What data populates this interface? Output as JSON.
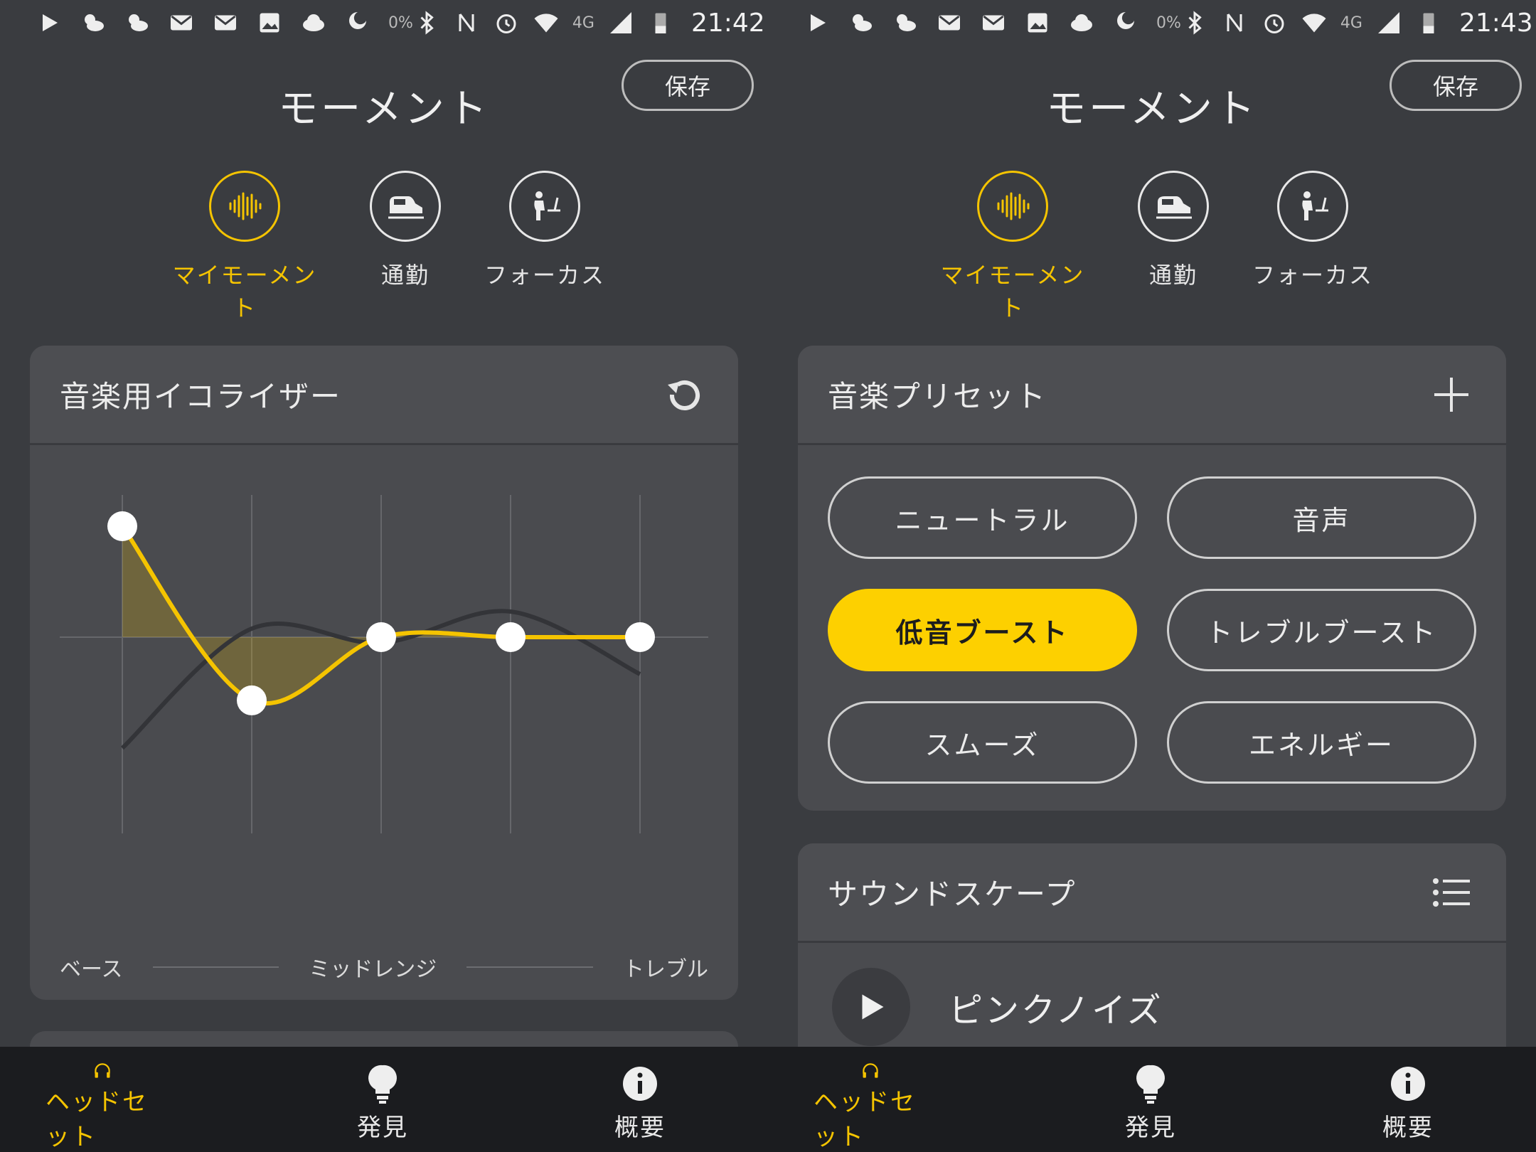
{
  "accent_color": "#f5c400",
  "screens": [
    {
      "status": {
        "time": "21:42",
        "network": "4G",
        "battery_small": "0%"
      },
      "header": {
        "title": "モーメント",
        "save_label": "保存"
      },
      "moments": [
        {
          "label": "マイモーメント",
          "icon": "waveform-icon",
          "active": true
        },
        {
          "label": "通勤",
          "icon": "train-icon",
          "active": false
        },
        {
          "label": "フォーカス",
          "icon": "focus-person-icon",
          "active": false
        }
      ],
      "eq_card": {
        "title": "音楽用イコライザー",
        "action_icon": "reset-icon",
        "legend": {
          "bass": "ベース",
          "mid": "ミッドレンジ",
          "treble": "トレブル"
        },
        "bands": [
          1.0,
          -0.57,
          0.0,
          0.0,
          0.0
        ],
        "range": [
          -1,
          1
        ]
      }
    },
    {
      "status": {
        "time": "21:43",
        "network": "4G",
        "battery_small": "0%"
      },
      "header": {
        "title": "モーメント",
        "save_label": "保存"
      },
      "moments": [
        {
          "label": "マイモーメント",
          "icon": "waveform-icon",
          "active": true
        },
        {
          "label": "通勤",
          "icon": "train-icon",
          "active": false
        },
        {
          "label": "フォーカス",
          "icon": "focus-person-icon",
          "active": false
        }
      ],
      "preset_card": {
        "title": "音楽プリセット",
        "action_icon": "plus-icon",
        "presets": [
          {
            "label": "ニュートラル",
            "selected": false
          },
          {
            "label": "音声",
            "selected": false
          },
          {
            "label": "低音ブースト",
            "selected": true
          },
          {
            "label": "トレブルブースト",
            "selected": false
          },
          {
            "label": "スムーズ",
            "selected": false
          },
          {
            "label": "エネルギー",
            "selected": false
          }
        ]
      },
      "soundscape_card": {
        "title": "サウンドスケープ",
        "action_icon": "list-icon",
        "items": [
          {
            "label": "ピンクノイズ",
            "icon": "play-icon"
          }
        ]
      }
    }
  ],
  "bottom_nav": [
    {
      "label": "ヘッドセット",
      "icon": "headphones-icon",
      "active": true
    },
    {
      "label": "発見",
      "icon": "lightbulb-icon",
      "active": false
    },
    {
      "label": "概要",
      "icon": "info-icon",
      "active": false
    }
  ]
}
